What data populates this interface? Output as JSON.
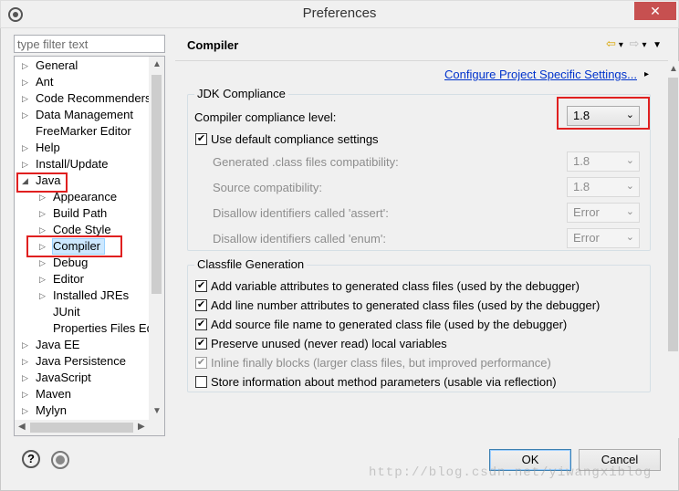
{
  "window": {
    "title": "Preferences",
    "close_glyph": "✕"
  },
  "filter": {
    "placeholder": "type filter text"
  },
  "tree": {
    "items": [
      {
        "label": "General",
        "arrow": "▷"
      },
      {
        "label": "Ant",
        "arrow": "▷"
      },
      {
        "label": "Code Recommenders",
        "arrow": "▷"
      },
      {
        "label": "Data Management",
        "arrow": "▷"
      },
      {
        "label": "FreeMarker Editor",
        "arrow": ""
      },
      {
        "label": "Help",
        "arrow": "▷"
      },
      {
        "label": "Install/Update",
        "arrow": "▷"
      },
      {
        "label": "Java",
        "arrow": "◢"
      },
      {
        "label": "Appearance",
        "arrow": "▷"
      },
      {
        "label": "Build Path",
        "arrow": "▷"
      },
      {
        "label": "Code Style",
        "arrow": "▷"
      },
      {
        "label": "Compiler",
        "arrow": "▷"
      },
      {
        "label": "Debug",
        "arrow": "▷"
      },
      {
        "label": "Editor",
        "arrow": "▷"
      },
      {
        "label": "Installed JREs",
        "arrow": "▷"
      },
      {
        "label": "JUnit",
        "arrow": ""
      },
      {
        "label": "Properties Files Ed",
        "arrow": ""
      },
      {
        "label": "Java EE",
        "arrow": "▷"
      },
      {
        "label": "Java Persistence",
        "arrow": "▷"
      },
      {
        "label": "JavaScript",
        "arrow": "▷"
      },
      {
        "label": "Maven",
        "arrow": "▷"
      },
      {
        "label": "Mylyn",
        "arrow": "▷"
      }
    ]
  },
  "page": {
    "title": "Compiler",
    "config_link": "Configure Project Specific Settings...",
    "jdk": {
      "group_title": "JDK Compliance",
      "level_label": "Compiler compliance level:",
      "level_value": "1.8",
      "use_default_label": "Use default compliance settings",
      "use_default_checked": "✔",
      "rows": [
        {
          "label": "Generated .class files compatibility:",
          "value": "1.8"
        },
        {
          "label": "Source compatibility:",
          "value": "1.8"
        },
        {
          "label": "Disallow identifiers called 'assert':",
          "value": "Error"
        },
        {
          "label": "Disallow identifiers called 'enum':",
          "value": "Error"
        }
      ]
    },
    "classfile": {
      "group_title": "Classfile Generation",
      "options": [
        {
          "label": "Add variable attributes to generated class files (used by the debugger)",
          "mark": "✔"
        },
        {
          "label": "Add line number attributes to generated class files (used by the debugger)",
          "mark": "✔"
        },
        {
          "label": "Add source file name to generated class file (used by the debugger)",
          "mark": "✔"
        },
        {
          "label": "Preserve unused (never read) local variables",
          "mark": "✔"
        },
        {
          "label": "Inline finally blocks (larger class files, but improved performance)",
          "mark": "✔"
        },
        {
          "label": "Store information about method parameters (usable via reflection)",
          "mark": ""
        }
      ]
    }
  },
  "buttons": {
    "ok": "OK",
    "cancel": "Cancel",
    "help_glyph": "?"
  },
  "watermark": "http://blog.csdn.net/yiwangxiblog",
  "colors": {
    "highlight_red": "#e02020",
    "link": "#0033cc",
    "selection": "#cde8ff"
  }
}
